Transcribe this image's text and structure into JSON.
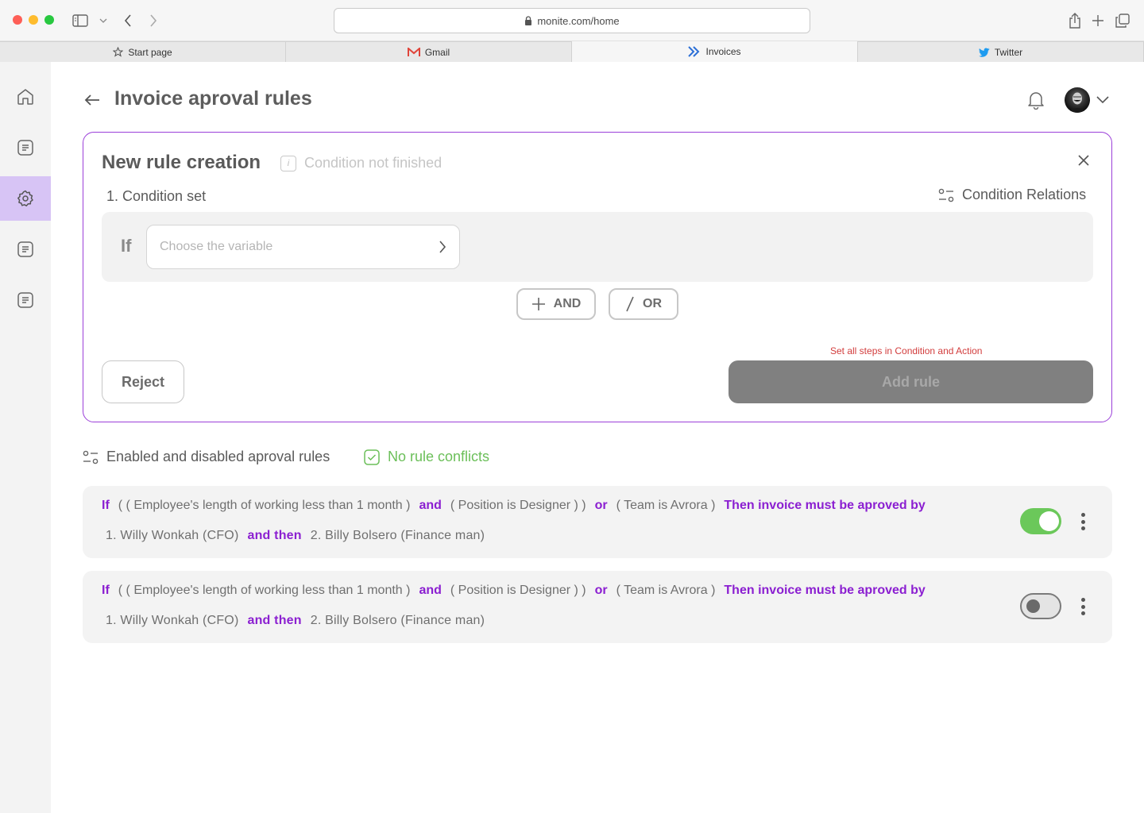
{
  "browser": {
    "url": "monite.com/home",
    "tabs": [
      {
        "label": "Start page",
        "icon": "star-icon"
      },
      {
        "label": "Gmail",
        "icon": "gmail-icon"
      },
      {
        "label": "Invoices",
        "icon": "monite-icon",
        "active": true
      },
      {
        "label": "Twitter",
        "icon": "twitter-icon"
      }
    ]
  },
  "sidebar": {
    "items": [
      {
        "icon": "home-icon"
      },
      {
        "icon": "document-icon"
      },
      {
        "icon": "gear-icon",
        "active": true
      },
      {
        "icon": "document-icon"
      },
      {
        "icon": "document-icon"
      }
    ]
  },
  "header": {
    "title": "Invoice aproval rules"
  },
  "new_rule": {
    "title": "New rule creation",
    "status": "Condition not finished",
    "condition_set_label": "1. Condition set",
    "condition_relations_label": "Condition Relations",
    "if_label": "If",
    "variable_placeholder": "Choose the variable",
    "and_label": "AND",
    "or_label": "OR",
    "hint": "Set all steps in Condition and Action",
    "reject_label": "Reject",
    "add_rule_label": "Add rule"
  },
  "rules_section": {
    "title": "Enabled and disabled aproval rules",
    "conflicts_status": "No rule conflicts"
  },
  "rules": [
    {
      "if": "If",
      "cond1": "( ( Employee's length of working less than 1 month )",
      "and": "and",
      "cond2": "( Position is Designer ) )",
      "or": "or",
      "cond3": "( Team is Avrora )",
      "then": "Then invoice must be aproved by",
      "approver1": "1. Willy Wonkah (CFO)",
      "and_then": "and then",
      "approver2": "2. Billy Bolsero (Finance man)",
      "enabled": true
    },
    {
      "if": "If",
      "cond1": "( ( Employee's length of working less than 1 month )",
      "and": "and",
      "cond2": "( Position is Designer ) )",
      "or": "or",
      "cond3": "( Team is Avrora )",
      "then": "Then invoice must be aproved by",
      "approver1": "1. Willy Wonkah (CFO)",
      "and_then": "and then",
      "approver2": "2. Billy Bolsero (Finance man)",
      "enabled": false
    }
  ],
  "colors": {
    "accent": "#8b1fd1",
    "sidebar_active": "#d7c4f5",
    "success": "#6bc85a",
    "error": "#d23c3c"
  }
}
